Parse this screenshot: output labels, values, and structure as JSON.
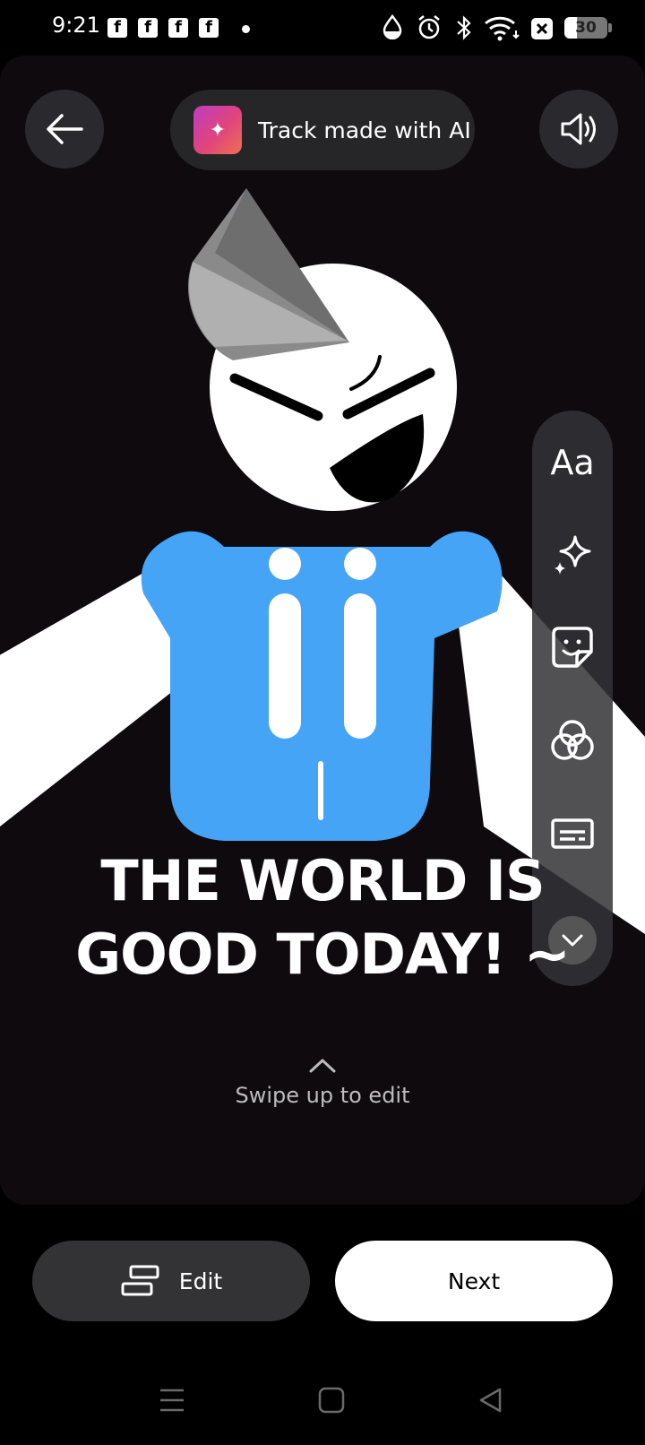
{
  "status_bar": {
    "time": "9:21",
    "notification_icons": [
      "facebook-icon",
      "facebook-icon",
      "facebook-icon",
      "facebook-icon"
    ],
    "system_icons": [
      "water-drop-icon",
      "alarm-icon",
      "bluetooth-icon",
      "wifi-icon",
      "close-box-icon"
    ],
    "battery_level": "30"
  },
  "header": {
    "back_icon": "arrow-left-icon",
    "track_label": "Track made with AI",
    "track_icon": "sparkle-icon",
    "sound_icon": "speaker-icon"
  },
  "tools": {
    "text_label": "Aa",
    "items": [
      "text-tool",
      "sparkle-effects-icon",
      "sticker-icon",
      "filters-icon",
      "captions-icon",
      "chevron-down-icon"
    ]
  },
  "caption": {
    "line1": "THE WORLD IS",
    "line2": "GOOD TODAY! ~"
  },
  "swipe_hint": "Swipe up to edit",
  "buttons": {
    "edit_label": "Edit",
    "next_label": "Next"
  },
  "colors": {
    "shirt": "#45a4f5",
    "background": "#0f0a0e",
    "pill": "#262628"
  }
}
